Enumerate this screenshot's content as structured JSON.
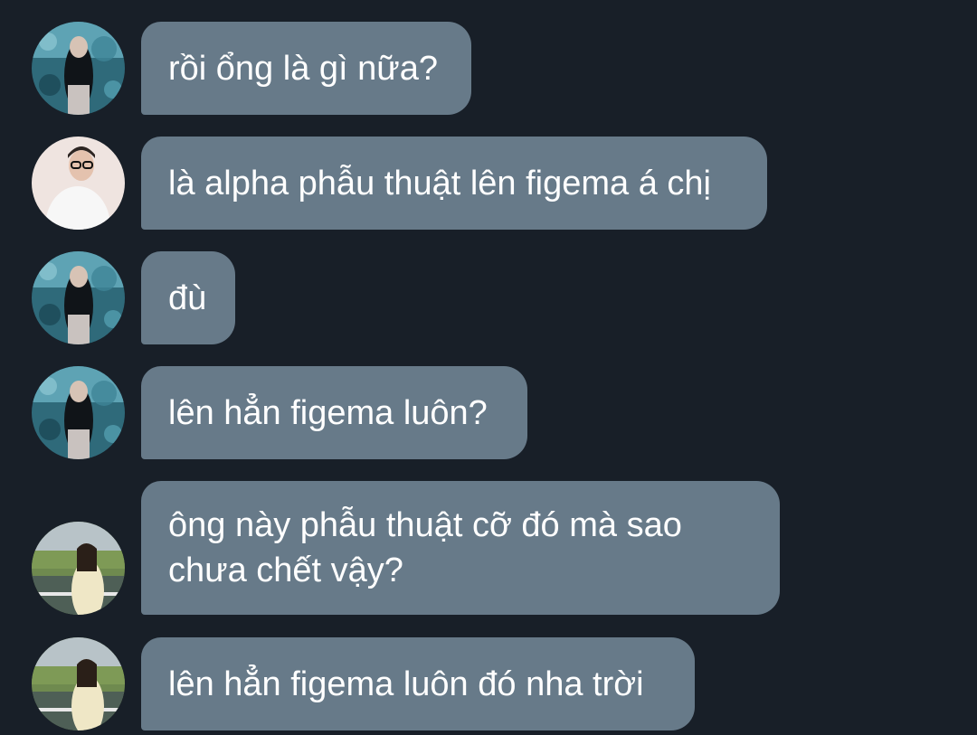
{
  "messages": [
    {
      "avatar": "aquarium-girl-avatar",
      "text": "rồi ổng là gì nữa?"
    },
    {
      "avatar": "glasses-boy-avatar",
      "text": "là alpha phẫu thuật lên figema á chị"
    },
    {
      "avatar": "aquarium-girl-avatar",
      "text": "đù"
    },
    {
      "avatar": "aquarium-girl-avatar",
      "text": "lên hẳn figema luôn?"
    },
    {
      "avatar": "field-girl-avatar",
      "text": "ông này phẫu thuật cỡ đó mà sao\nchưa chết vậy?"
    },
    {
      "avatar": "field-girl-avatar",
      "text": "lên hẳn figema luôn đó nha trời"
    }
  ],
  "colors": {
    "background": "#181f28",
    "bubble": "#677a89",
    "text": "#ffffff"
  }
}
